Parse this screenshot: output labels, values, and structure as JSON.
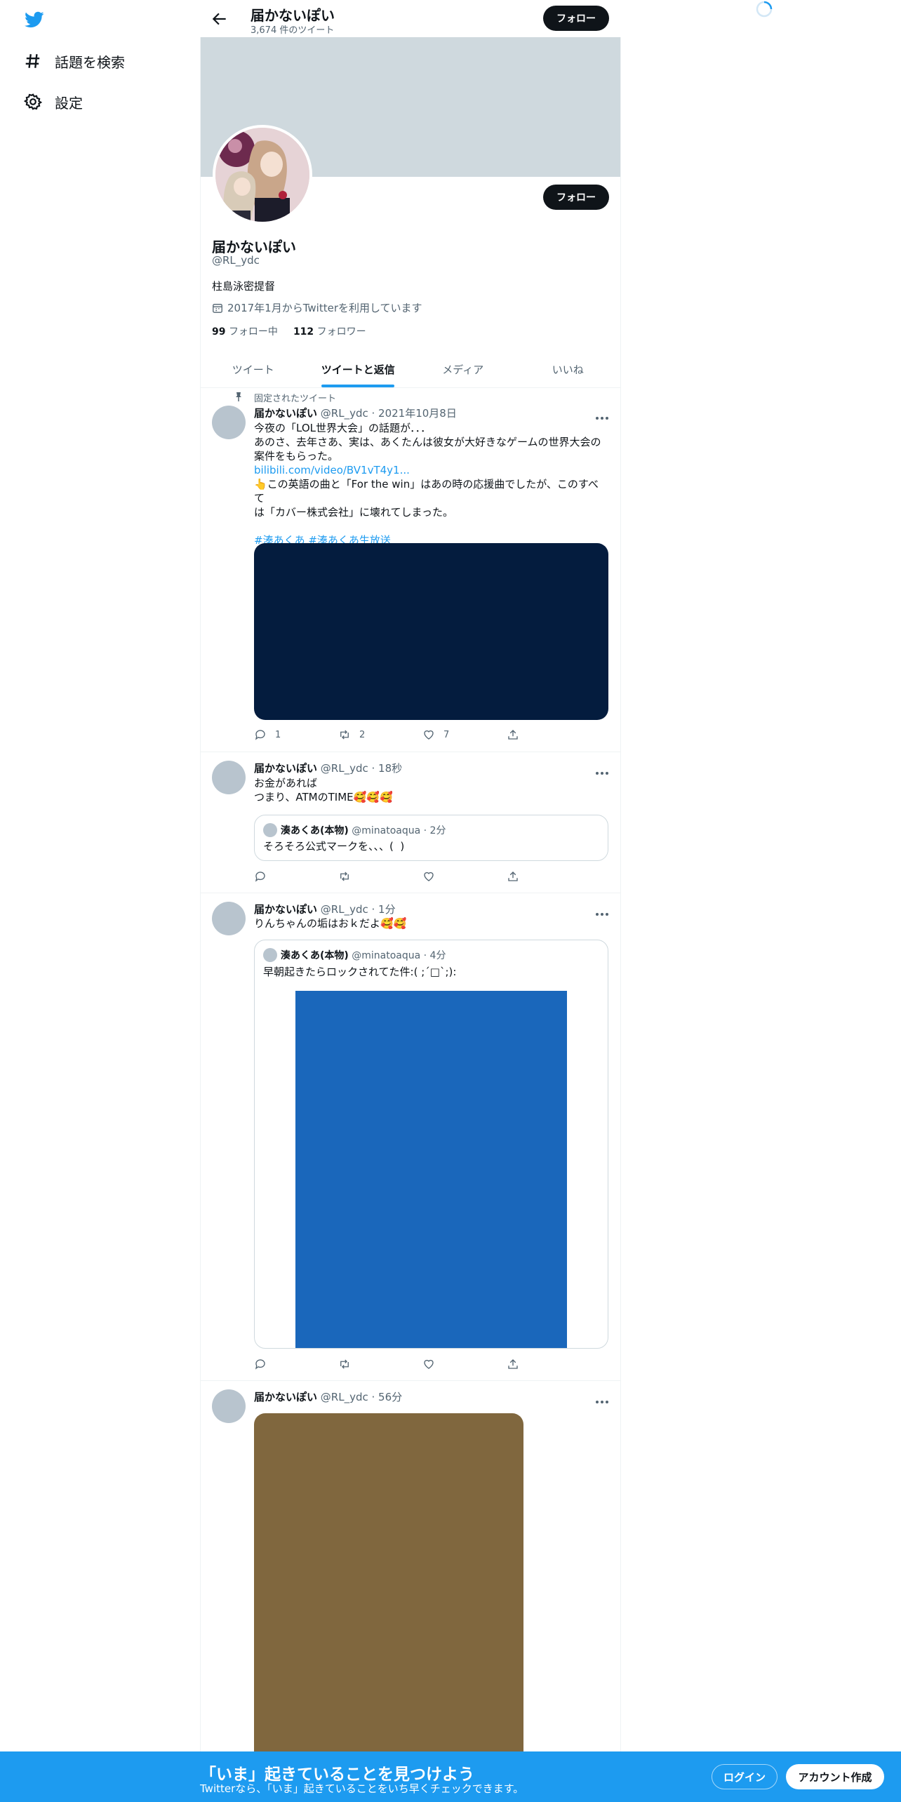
{
  "nav": {
    "items": [
      {
        "label": "話題を検索",
        "icon": "hashtag-icon"
      },
      {
        "label": "設定",
        "icon": "gear-icon"
      }
    ]
  },
  "header": {
    "name": "届かないぽい",
    "tweet_count": "3,674 件のツイート",
    "follow_label": "フォロー"
  },
  "profile": {
    "display_name": "届かないぽい",
    "handle": "@RL_ydc",
    "bio": "柱島泳密提督",
    "joined": "2017年1月からTwitterを利用しています",
    "following_count": "99",
    "following_label": "フォロー中",
    "followers_count": "112",
    "followers_label": "フォロワー",
    "follow_label": "フォロー"
  },
  "tabs": [
    "ツイート",
    "ツイートと返信",
    "メディア",
    "いいね"
  ],
  "tweets": [
    {
      "pinned_label": "固定されたツイート",
      "name": "届かないぽい",
      "meta": "@RL_ydc · 2021年10月8日",
      "lines": [
        "今夜の「LOL世界大会」の話題が．．．",
        "あのさ、去年さあ、実は、あくたんは彼女が大好きなゲームの世界大会の",
        "案件をもらった。"
      ],
      "link": "bilibili.com/video/BV1vT4y1...",
      "lines2": [
        "👆この英語の曲と「For the win」はあの時の応援曲でしたが、このすべて",
        "は「カバー株式会社」に壊れてしまった。"
      ],
      "hashtags": "#湊あくあ #湊あくあ生放送",
      "reply": "1",
      "retweet": "2",
      "like": "7"
    },
    {
      "name": "届かないぽい",
      "meta": "@RL_ydc · 18秒",
      "lines": [
        "お金があれば",
        "つまり、ATMのTIME🥰🥰🥰"
      ],
      "quote_name": "湊あくあ(本物)",
      "quote_meta": "@minatoaqua · 2分",
      "quote_text": "そろそろ公式マークを、、、( ︎︎︎︎︎︎ )"
    },
    {
      "name": "届かないぽい",
      "meta": "@RL_ydc · 1分",
      "lines": [
        "りんちゃんの垢はおｋだよ🥰🥰"
      ],
      "quote_name": "湊あくあ(本物)",
      "quote_meta": "@minatoaqua · 4分",
      "quote_text": "早朝起きたらロックされてた件:( ;´□`;):"
    },
    {
      "name": "届かないぽい",
      "meta": "@RL_ydc · 56分"
    }
  ],
  "bottom_bar": {
    "title": "「いま」起きていることを見つけよう",
    "subtitle": "Twitterなら、「いま」起きていることをいち早くチェックできます。",
    "login_label": "ログイン",
    "signup_label": "アカウント作成"
  },
  "colors": {
    "accent": "#1d9bf0",
    "media_1": "#041c3e",
    "media_2": "#1a67bb",
    "media_3": "#80673e",
    "banner": "#cfd9de"
  }
}
